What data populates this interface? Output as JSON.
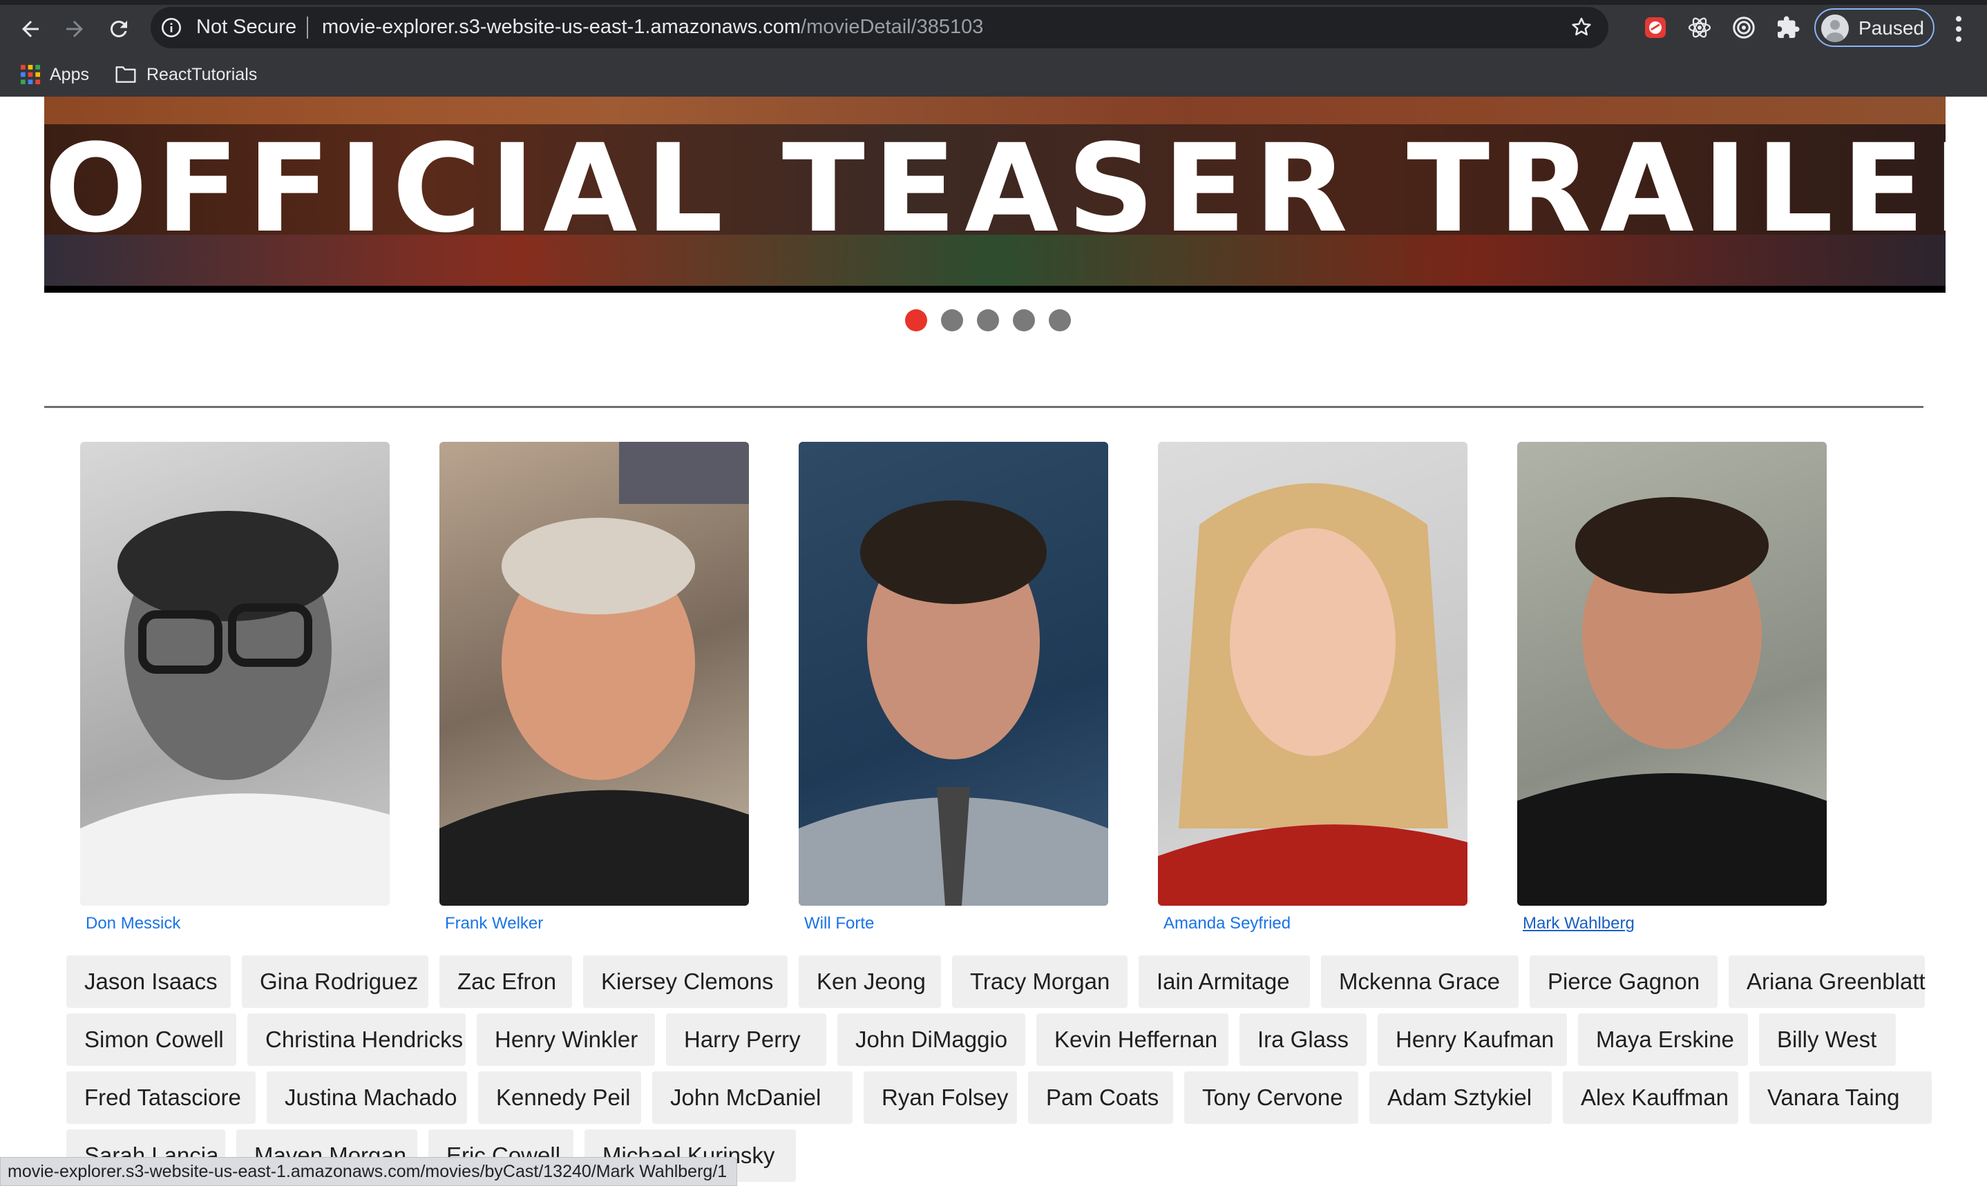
{
  "browser": {
    "security_label": "Not Secure",
    "url_host": "movie-explorer.s3-website-us-east-1.amazonaws.com",
    "url_path": "/movieDetail/385103",
    "profile_label": "Paused",
    "bookmarks": [
      {
        "label": "Apps",
        "icon": "apps-grid-icon"
      },
      {
        "label": "ReactTutorials",
        "icon": "folder-icon"
      }
    ],
    "extensions": [
      "red-extension-icon",
      "react-devtools-icon",
      "target-extension-icon",
      "puzzle-extensions-icon"
    ]
  },
  "trailer": {
    "banner_text": "OFFICIAL TEASER TRAILER",
    "slide_count": 5,
    "active_slide": 1
  },
  "cast": [
    {
      "name": "Don Messick",
      "photo": "bw-portrait"
    },
    {
      "name": "Frank Welker",
      "photo": "color-portrait"
    },
    {
      "name": "Will Forte",
      "photo": "color-portrait"
    },
    {
      "name": "Amanda Seyfried",
      "photo": "color-portrait"
    },
    {
      "name": "Mark Wahlberg",
      "photo": "color-portrait",
      "hovered": true
    }
  ],
  "more_cast": [
    "Jason Isaacs",
    "Gina Rodriguez",
    "Zac Efron",
    "Kiersey Clemons",
    "Ken Jeong",
    "Tracy Morgan",
    "Iain Armitage",
    "Mckenna Grace",
    "Pierce Gagnon",
    "Ariana Greenblatt",
    "Simon Cowell",
    "Christina Hendricks",
    "Henry Winkler",
    "Harry Perry",
    "John DiMaggio",
    "Kevin Heffernan",
    "Ira Glass",
    "Henry Kaufman",
    "Maya Erskine",
    "Billy West",
    "Fred Tatasciore",
    "Justina Machado",
    "Kennedy Peil",
    "John McDaniel",
    "Ryan Folsey",
    "Pam Coats",
    "Tony Cervone",
    "Adam Sztykiel",
    "Alex Kauffman",
    "Vanara Taing",
    "Sarah Lancia",
    "Maven Morgan",
    "Eric Cowell",
    "Michael Kurinsky"
  ],
  "status_bar": "movie-explorer.s3-website-us-east-1.amazonaws.com/movies/byCast/13240/Mark Wahlberg/1",
  "colors": {
    "chrome_bg": "#35363a",
    "active_dot": "#e8332a",
    "link": "#1a73e8",
    "chip_bg": "#efefef"
  }
}
